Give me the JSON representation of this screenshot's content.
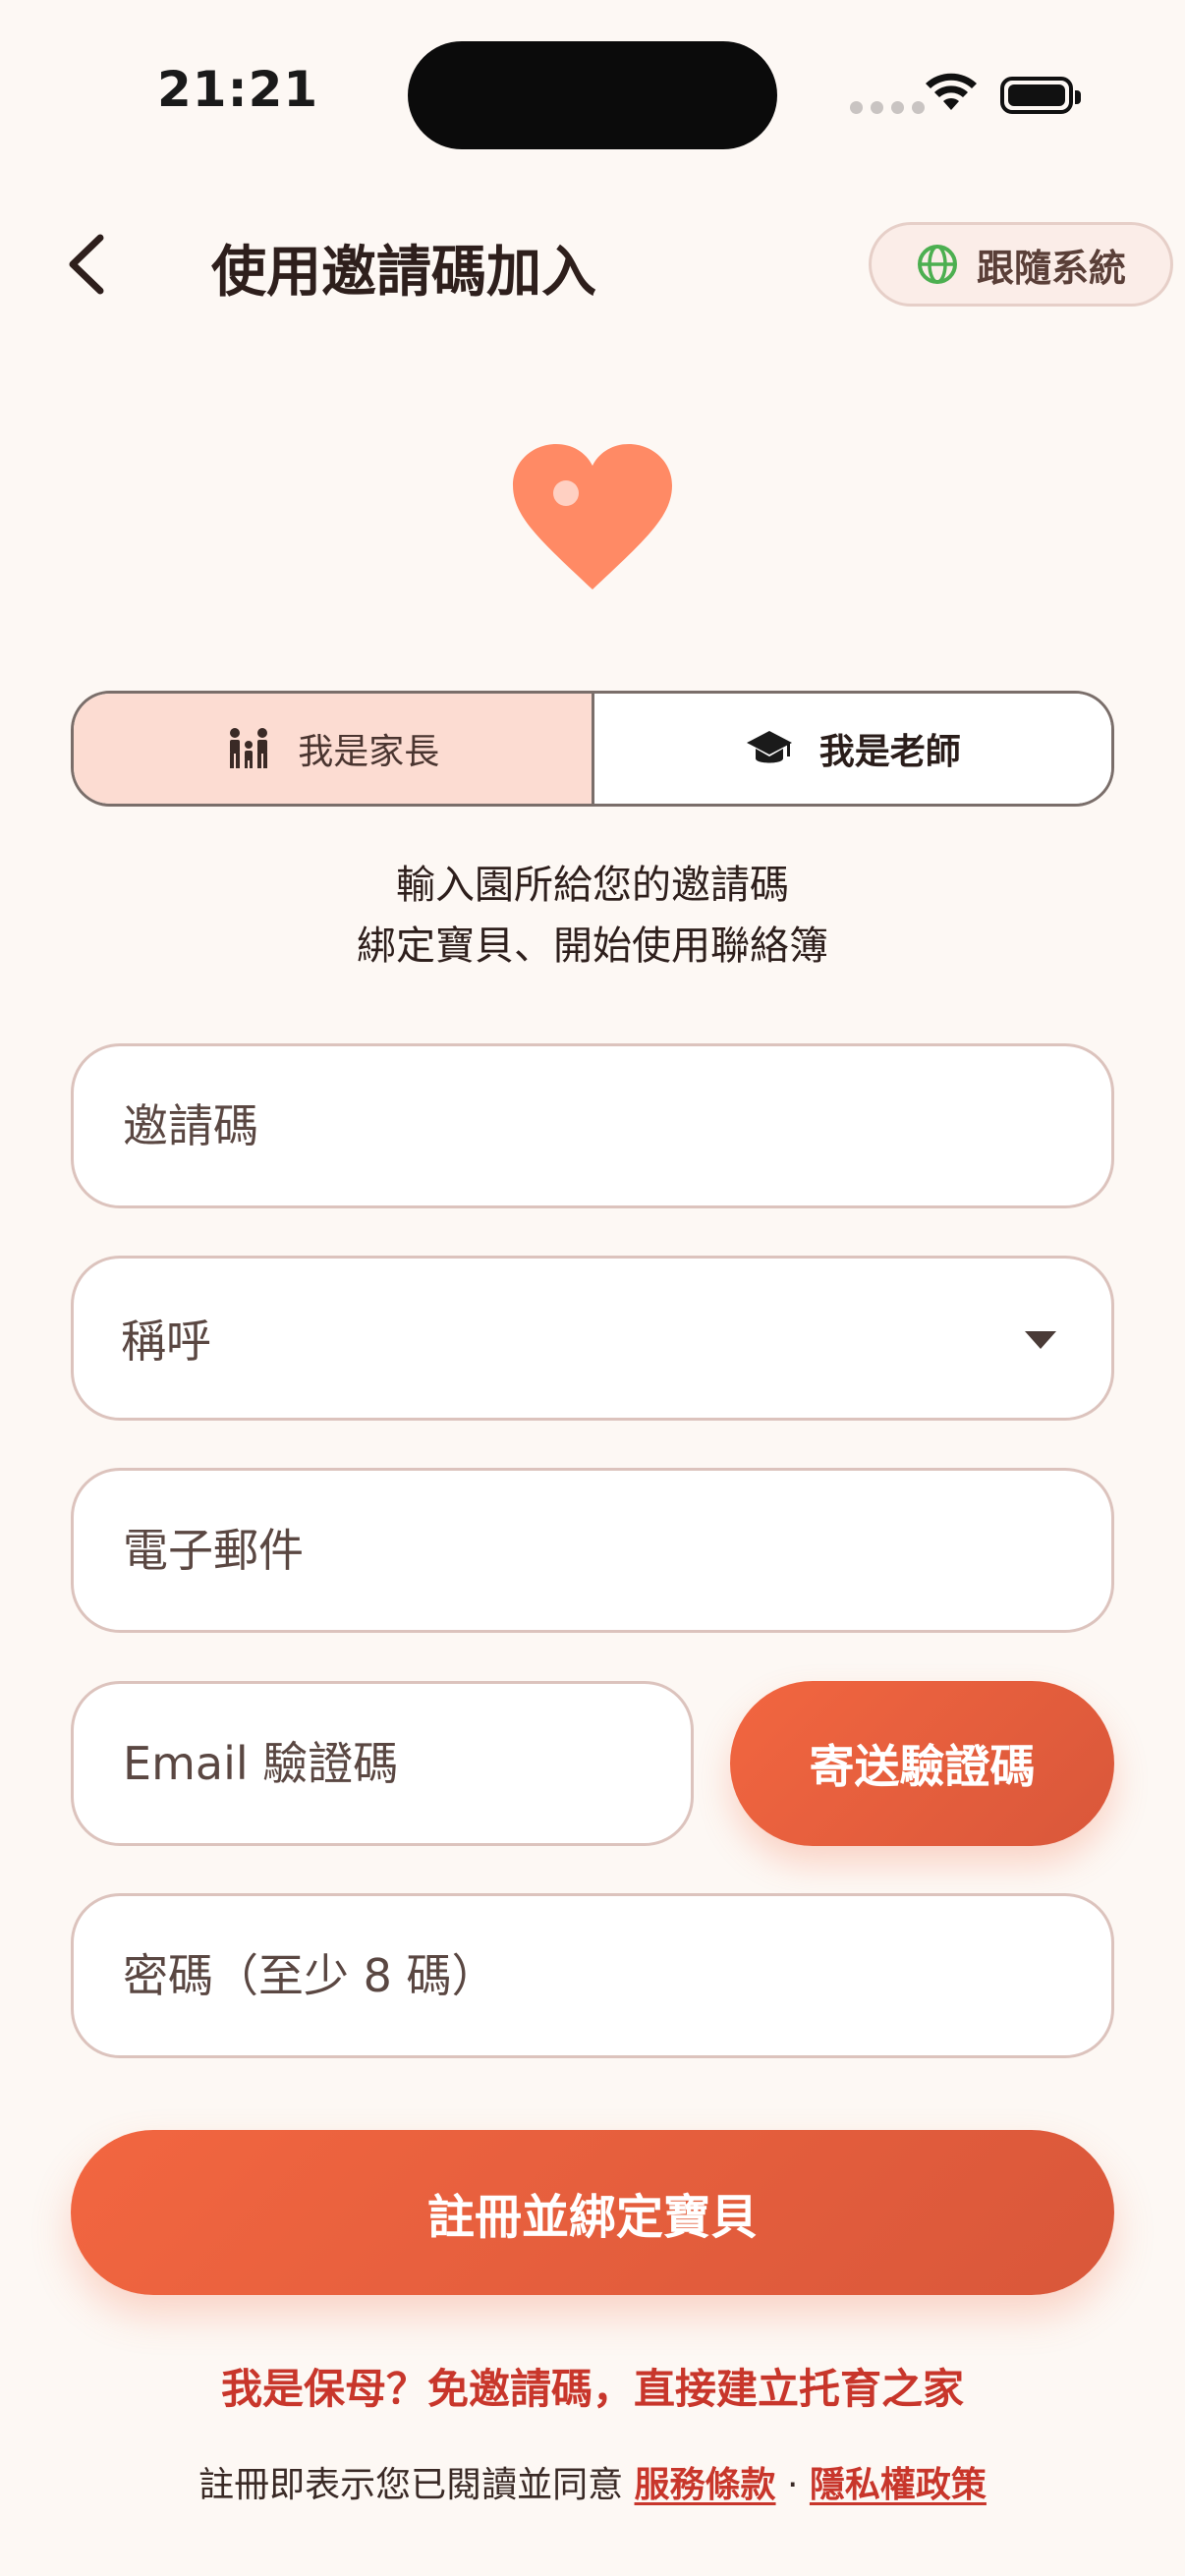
{
  "status": {
    "time": "21:21"
  },
  "header": {
    "title": "使用邀請碼加入",
    "language_label": "跟隨系統"
  },
  "role_tabs": [
    {
      "label": "我是家長",
      "icon": "family-icon",
      "selected": true
    },
    {
      "label": "我是老師",
      "icon": "graduation-cap-icon",
      "selected": false
    }
  ],
  "subtitle": {
    "line1": "輸入園所給您的邀請碼",
    "line2": "綁定寶貝、開始使用聯絡簿"
  },
  "form": {
    "invite_code_placeholder": "邀請碼",
    "title_select_placeholder": "稱呼",
    "email_placeholder": "電子郵件",
    "email_code_placeholder": "Email 驗證碼",
    "send_code_label": "寄送驗證碼",
    "password_placeholder": "密碼（至少 8 碼）"
  },
  "submit_label": "註冊並綁定寶貝",
  "nanny_link": "我是保母？免邀請碼，直接建立托育之家",
  "terms": {
    "prefix": "註冊即表示您已閱讀並同意",
    "tos": "服務條款",
    "separator": "·",
    "privacy": "隱私權政策"
  },
  "colors": {
    "accent": "#F26640",
    "background": "#FDF8F4",
    "link": "#C8362B",
    "selected_tab": "#FCDCD2"
  }
}
